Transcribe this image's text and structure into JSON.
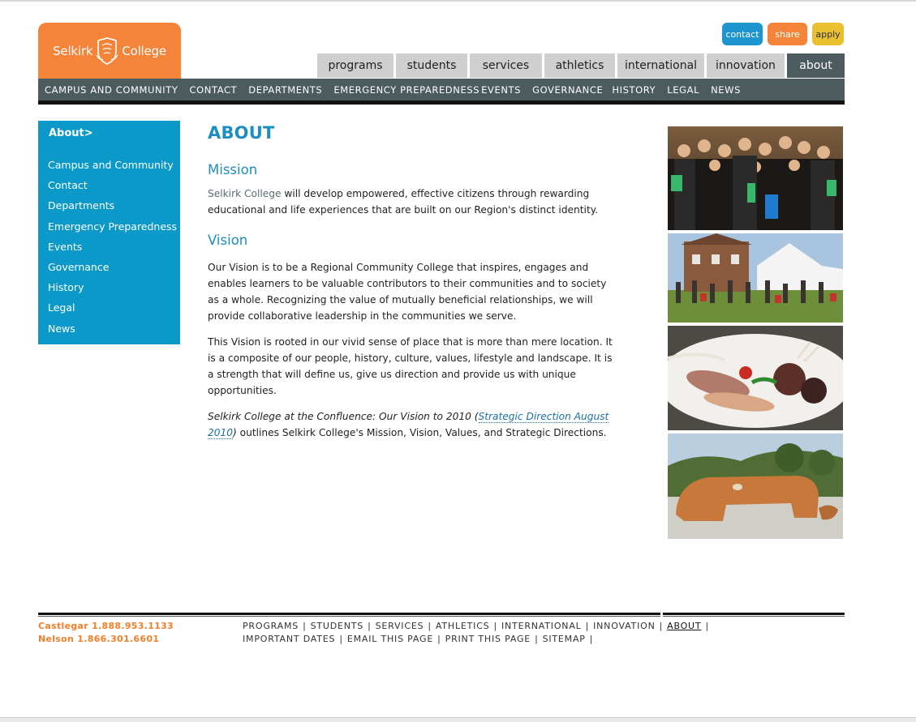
{
  "header": {
    "logo_left": "Selkirk",
    "logo_right": "College",
    "util_buttons": [
      "contact",
      "share",
      "apply"
    ],
    "tabs": [
      "programs",
      "students",
      "services",
      "athletics",
      "international",
      "innovation",
      "about"
    ],
    "active_tab": "about",
    "subnav": [
      "CAMPUS AND COMMUNITY",
      "CONTACT",
      "DEPARTMENTS",
      "EMERGENCY PREPAREDNESS",
      "EVENTS",
      "GOVERNANCE",
      "HISTORY",
      "LEGAL",
      "NEWS"
    ]
  },
  "sidebar": {
    "heading": "About>",
    "items": [
      "Campus and Community",
      "Contact",
      "Departments",
      "Emergency Preparedness",
      "Events",
      "Governance",
      "History",
      "Legal",
      "News"
    ]
  },
  "main": {
    "title": "ABOUT",
    "mission_heading": "Mission",
    "mission_link": "Selkirk College",
    "mission_text": " will develop empowered, effective citizens through rewarding educational and life experiences that are built on our Region's distinct identity.",
    "vision_heading": "Vision",
    "vision_p1": "Our Vision is to be a Regional Community College that inspires, engages and enables learners to be valuable contributors to their communities and to society as a whole. Recognizing the value of mutually beneficial relationships, we will provide collaborative leadership in the communities we serve.",
    "vision_p2": "This Vision is rooted in our vivid sense of place that is more than mere location. It is a composite of our people, history, culture, values, lifestyle and landscape. It is a strength that will define us, give us direction and provide us with unique opportunities.",
    "vision_p3_italic": "Selkirk College at the Confluence: Our Vision to 2010 (",
    "vision_p3_link": "Strategic Direction August 2010",
    "vision_p3_italic_end": ")",
    "vision_p3_rest": " outlines Selkirk College's Mission, Vision, Values, and Strategic Directions."
  },
  "footer": {
    "phone1": "Castlegar 1.888.953.1133",
    "phone2": "Nelson 1.866.301.6601",
    "links_row1": [
      "PROGRAMS",
      "STUDENTS",
      "SERVICES",
      "ATHLETICS",
      "INTERNATIONAL",
      "INNOVATION",
      "ABOUT"
    ],
    "links_row2": [
      "IMPORTANT DATES",
      "EMAIL THIS PAGE",
      "PRINT THIS PAGE",
      "SITEMAP"
    ]
  },
  "colors": {
    "brand_orange": "#f5843b",
    "brand_blue": "#0a99c9",
    "nav_dark": "#4b5b5e",
    "heading_blue": "#1e8ec0"
  }
}
